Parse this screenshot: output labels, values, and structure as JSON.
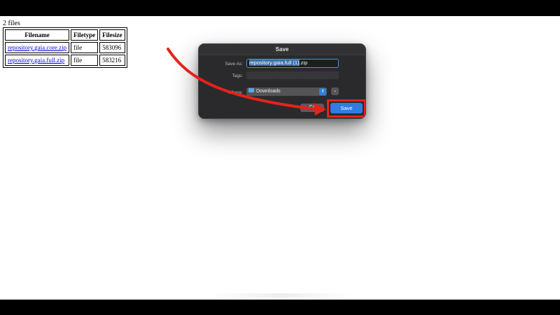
{
  "page": {
    "file_count": "2 files",
    "table": {
      "headers": [
        "Filename",
        "Filetype",
        "Filesize"
      ],
      "rows": [
        {
          "filename": "repository.gaia.core.zip",
          "filetype": "file",
          "filesize": "583096"
        },
        {
          "filename": "repository.gaia.full.zip",
          "filetype": "file",
          "filesize": "583216"
        }
      ]
    }
  },
  "dialog": {
    "title": "Save",
    "save_as_label": "Save As:",
    "save_as_selected": "repository.gaia.full (1)",
    "save_as_suffix": ".zip",
    "tags_label": "Tags:",
    "where_label": "Where:",
    "where_value": "Downloads",
    "cancel_label": "Ca",
    "save_label": "Save"
  },
  "icons": {
    "folder": "folder-icon",
    "select_chevron": "up-down-chevron-icon",
    "expand": "chevron-down-icon"
  },
  "colors": {
    "annotation_red": "#e4231b",
    "accent_blue": "#2f7de1",
    "link_blue": "#0000ee"
  }
}
